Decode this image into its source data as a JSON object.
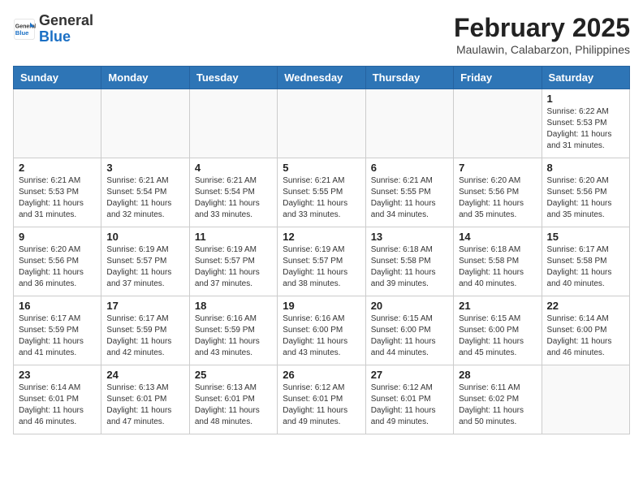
{
  "header": {
    "logo_general": "General",
    "logo_blue": "Blue",
    "month_year": "February 2025",
    "location": "Maulawin, Calabarzon, Philippines"
  },
  "weekdays": [
    "Sunday",
    "Monday",
    "Tuesday",
    "Wednesday",
    "Thursday",
    "Friday",
    "Saturday"
  ],
  "weeks": [
    [
      {
        "day": "",
        "info": ""
      },
      {
        "day": "",
        "info": ""
      },
      {
        "day": "",
        "info": ""
      },
      {
        "day": "",
        "info": ""
      },
      {
        "day": "",
        "info": ""
      },
      {
        "day": "",
        "info": ""
      },
      {
        "day": "1",
        "info": "Sunrise: 6:22 AM\nSunset: 5:53 PM\nDaylight: 11 hours\nand 31 minutes."
      }
    ],
    [
      {
        "day": "2",
        "info": "Sunrise: 6:21 AM\nSunset: 5:53 PM\nDaylight: 11 hours\nand 31 minutes."
      },
      {
        "day": "3",
        "info": "Sunrise: 6:21 AM\nSunset: 5:54 PM\nDaylight: 11 hours\nand 32 minutes."
      },
      {
        "day": "4",
        "info": "Sunrise: 6:21 AM\nSunset: 5:54 PM\nDaylight: 11 hours\nand 33 minutes."
      },
      {
        "day": "5",
        "info": "Sunrise: 6:21 AM\nSunset: 5:55 PM\nDaylight: 11 hours\nand 33 minutes."
      },
      {
        "day": "6",
        "info": "Sunrise: 6:21 AM\nSunset: 5:55 PM\nDaylight: 11 hours\nand 34 minutes."
      },
      {
        "day": "7",
        "info": "Sunrise: 6:20 AM\nSunset: 5:56 PM\nDaylight: 11 hours\nand 35 minutes."
      },
      {
        "day": "8",
        "info": "Sunrise: 6:20 AM\nSunset: 5:56 PM\nDaylight: 11 hours\nand 35 minutes."
      }
    ],
    [
      {
        "day": "9",
        "info": "Sunrise: 6:20 AM\nSunset: 5:56 PM\nDaylight: 11 hours\nand 36 minutes."
      },
      {
        "day": "10",
        "info": "Sunrise: 6:19 AM\nSunset: 5:57 PM\nDaylight: 11 hours\nand 37 minutes."
      },
      {
        "day": "11",
        "info": "Sunrise: 6:19 AM\nSunset: 5:57 PM\nDaylight: 11 hours\nand 37 minutes."
      },
      {
        "day": "12",
        "info": "Sunrise: 6:19 AM\nSunset: 5:57 PM\nDaylight: 11 hours\nand 38 minutes."
      },
      {
        "day": "13",
        "info": "Sunrise: 6:18 AM\nSunset: 5:58 PM\nDaylight: 11 hours\nand 39 minutes."
      },
      {
        "day": "14",
        "info": "Sunrise: 6:18 AM\nSunset: 5:58 PM\nDaylight: 11 hours\nand 40 minutes."
      },
      {
        "day": "15",
        "info": "Sunrise: 6:17 AM\nSunset: 5:58 PM\nDaylight: 11 hours\nand 40 minutes."
      }
    ],
    [
      {
        "day": "16",
        "info": "Sunrise: 6:17 AM\nSunset: 5:59 PM\nDaylight: 11 hours\nand 41 minutes."
      },
      {
        "day": "17",
        "info": "Sunrise: 6:17 AM\nSunset: 5:59 PM\nDaylight: 11 hours\nand 42 minutes."
      },
      {
        "day": "18",
        "info": "Sunrise: 6:16 AM\nSunset: 5:59 PM\nDaylight: 11 hours\nand 43 minutes."
      },
      {
        "day": "19",
        "info": "Sunrise: 6:16 AM\nSunset: 6:00 PM\nDaylight: 11 hours\nand 43 minutes."
      },
      {
        "day": "20",
        "info": "Sunrise: 6:15 AM\nSunset: 6:00 PM\nDaylight: 11 hours\nand 44 minutes."
      },
      {
        "day": "21",
        "info": "Sunrise: 6:15 AM\nSunset: 6:00 PM\nDaylight: 11 hours\nand 45 minutes."
      },
      {
        "day": "22",
        "info": "Sunrise: 6:14 AM\nSunset: 6:00 PM\nDaylight: 11 hours\nand 46 minutes."
      }
    ],
    [
      {
        "day": "23",
        "info": "Sunrise: 6:14 AM\nSunset: 6:01 PM\nDaylight: 11 hours\nand 46 minutes."
      },
      {
        "day": "24",
        "info": "Sunrise: 6:13 AM\nSunset: 6:01 PM\nDaylight: 11 hours\nand 47 minutes."
      },
      {
        "day": "25",
        "info": "Sunrise: 6:13 AM\nSunset: 6:01 PM\nDaylight: 11 hours\nand 48 minutes."
      },
      {
        "day": "26",
        "info": "Sunrise: 6:12 AM\nSunset: 6:01 PM\nDaylight: 11 hours\nand 49 minutes."
      },
      {
        "day": "27",
        "info": "Sunrise: 6:12 AM\nSunset: 6:01 PM\nDaylight: 11 hours\nand 49 minutes."
      },
      {
        "day": "28",
        "info": "Sunrise: 6:11 AM\nSunset: 6:02 PM\nDaylight: 11 hours\nand 50 minutes."
      },
      {
        "day": "",
        "info": ""
      }
    ]
  ]
}
